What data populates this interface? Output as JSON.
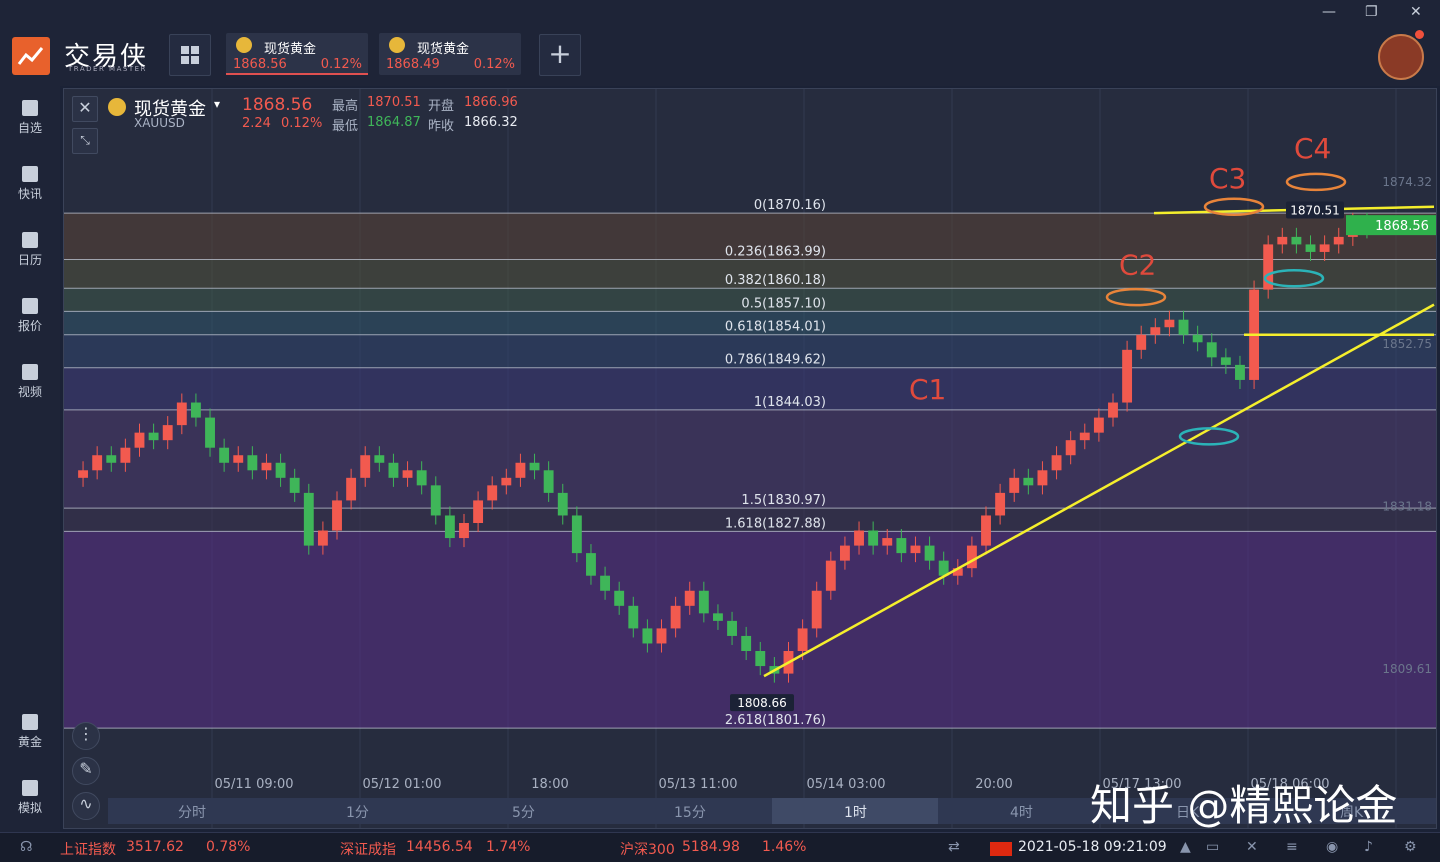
{
  "app": {
    "logo_text": "交易侠",
    "logo_sub": "TRADER MASTER"
  },
  "tabs": [
    {
      "name": "现货黄金",
      "price": "1868.56",
      "pct": "0.12%"
    },
    {
      "name": "现货黄金",
      "price": "1868.49",
      "pct": "0.12%"
    }
  ],
  "add_tab_label": "+",
  "window_controls": {
    "minimize": "—",
    "restore": "❐",
    "close": "✕"
  },
  "sidebar": {
    "items": [
      {
        "label": "自选",
        "icon": "bookmark-plus-icon"
      },
      {
        "label": "快讯",
        "icon": "news-icon"
      },
      {
        "label": "日历",
        "icon": "calendar-icon"
      },
      {
        "label": "报价",
        "icon": "quote-chart-icon"
      },
      {
        "label": "视频",
        "icon": "video-icon"
      }
    ],
    "bottom_items": [
      {
        "label": "黄金",
        "icon": "gold-icon"
      },
      {
        "label": "模拟",
        "icon": "simulation-icon"
      }
    ]
  },
  "instrument": {
    "name": "现货黄金",
    "symbol": "XAUUSD",
    "last": "1868.56",
    "change": "2.24",
    "change_pct": "0.12%",
    "high_label": "最高",
    "high": "1870.51",
    "low_label": "最低",
    "low": "1864.87",
    "open_label": "开盘",
    "open": "1866.96",
    "prev_close_label": "昨收",
    "prev_close": "1866.32"
  },
  "chart_data": {
    "type": "candlestick",
    "y_range": [
      1795,
      1880
    ],
    "price_axis_ticks": [
      "1874.32",
      "1852.75",
      "1831.18",
      "1809.61"
    ],
    "time_axis_labels": [
      "05/11 09:00",
      "05/12 01:00",
      "18:00",
      "05/13 11:00",
      "05/14 03:00",
      "20:00",
      "05/17 13:00",
      "05/18 06:00"
    ],
    "current_price_tag": "1868.56",
    "high_marker": "1870.51",
    "low_marker": "1808.66",
    "fibonacci_levels": [
      {
        "label": "0(1870.16)",
        "value": 1870.16
      },
      {
        "label": "0.236(1863.99)",
        "value": 1863.99
      },
      {
        "label": "0.382(1860.18)",
        "value": 1860.18
      },
      {
        "label": "0.5(1857.10)",
        "value": 1857.1
      },
      {
        "label": "0.618(1854.01)",
        "value": 1854.01
      },
      {
        "label": "0.786(1849.62)",
        "value": 1849.62
      },
      {
        "label": "1(1844.03)",
        "value": 1844.03
      },
      {
        "label": "1.5(1830.97)",
        "value": 1830.97
      },
      {
        "label": "1.618(1827.88)",
        "value": 1827.88
      },
      {
        "label": "2.618(1801.76)",
        "value": 1801.76
      }
    ],
    "annotations": [
      "C1",
      "C2",
      "C3",
      "C4"
    ],
    "close_series": [
      1836,
      1838,
      1837,
      1839,
      1841,
      1840,
      1842,
      1845,
      1843,
      1839,
      1837,
      1838,
      1836,
      1837,
      1835,
      1833,
      1826,
      1828,
      1832,
      1835,
      1838,
      1837,
      1835,
      1836,
      1834,
      1830,
      1827,
      1829,
      1832,
      1834,
      1835,
      1837,
      1836,
      1833,
      1830,
      1825,
      1822,
      1820,
      1818,
      1815,
      1813,
      1815,
      1818,
      1820,
      1817,
      1816,
      1814,
      1812,
      1810,
      1809,
      1812,
      1815,
      1820,
      1824,
      1826,
      1828,
      1826,
      1827,
      1825,
      1826,
      1824,
      1822,
      1823,
      1826,
      1830,
      1833,
      1835,
      1834,
      1836,
      1838,
      1840,
      1841,
      1843,
      1845,
      1852,
      1854,
      1855,
      1856,
      1854,
      1853,
      1851,
      1850,
      1848,
      1860,
      1866,
      1867,
      1866,
      1865,
      1866,
      1867,
      1869,
      1868
    ]
  },
  "timeframes": [
    "分时",
    "1分",
    "5分",
    "15分",
    "1时",
    "4时",
    "日K",
    "周K"
  ],
  "active_timeframe": "1时",
  "tools": [
    "indicator-icon",
    "draw-pen-icon",
    "wave-icon"
  ],
  "watermark": "知乎 @精熙论金",
  "status_bar": {
    "indices": [
      {
        "name": "上证指数",
        "value": "3517.62",
        "pct": "0.78%"
      },
      {
        "name": "深证成指",
        "value": "14456.54",
        "pct": "1.74%"
      },
      {
        "name": "沪深300",
        "value": "5184.98",
        "pct": "1.46%"
      }
    ],
    "datetime": "2021-05-18 09:21:09"
  },
  "colors": {
    "up": "#f25a4f",
    "down": "#3fb659",
    "trendline": "#f5ef2c",
    "accent": "#e8612c"
  }
}
